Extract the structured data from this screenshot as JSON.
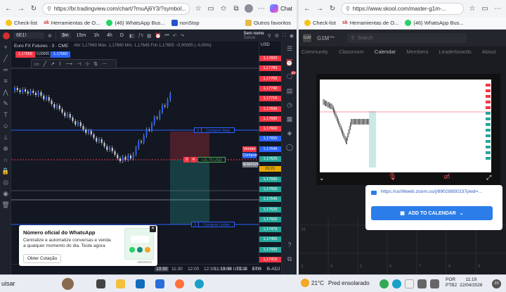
{
  "left_browser": {
    "url": "https://br.tradingview.com/chart/?muAj6Y3/?symbol...",
    "profile_btn": "Chat",
    "bookmarks": [
      "Check-list",
      "Herramientas de O...",
      "(46) WhatsApp Bus...",
      "nonStop"
    ],
    "other_favorites": "Outros favoritos"
  },
  "tv": {
    "symbol": "6E1!",
    "timeframes": [
      "3m",
      "15m",
      "1h",
      "4h",
      "D"
    ],
    "active_tf": "3m",
    "sem_nome": "Sem nome",
    "sem_nome_sub": "Salvar",
    "instrument_title": "Euro FX Futures · 3 · CME",
    "ohlc": "Abr 1,17660  Máx. 1,17660  Mín. 1,17645  Fch 1,17655  −0,00005 (−0,00%)",
    "sell_price": "1,17655",
    "buy_price": "1,17660",
    "spread": "0,00005",
    "currency": "USD",
    "price_labels": [
      "1,17820",
      "1,17785",
      "1,17765",
      "1,17740",
      "1,17715",
      "1,17695",
      "1,17680",
      "1,17660",
      "1,17655",
      "1,17645",
      "1,17625",
      "1,17610",
      "1,17590",
      "1,17565",
      "1,17545",
      "1,17525",
      "1,17500",
      "1,17475",
      "1,17455",
      "1,17430",
      "1,17415"
    ],
    "stop_label": "Comprar Stop",
    "stop_qty": "3",
    "limit_label": "Comprar Limite",
    "limit_qty": "3",
    "position_qty": "3",
    "position_pnl": "+16,75 USD",
    "vender_tag": "Vender",
    "comprar_tag": "Comprar",
    "contract_tag": "6EM2026",
    "countdown": "01:21",
    "time_labels": [
      "11:30",
      "12:00",
      "12:30",
      "13:00",
      "13:30",
      "14:0"
    ],
    "active_time_label": "10:30",
    "clock": "11:19:39 UTC-3",
    "session": "ETH",
    "adj": "B-ADJ"
  },
  "whatsapp_toast": {
    "title": "Número oficial do WhatsApp",
    "body": "Centralize e automatize conversas e venda a qualquer momento do dia. Teste agora",
    "button": "Obter Cotação",
    "ad_tag": "ANÚNCIO"
  },
  "right_browser": {
    "url": "https://www.skool.com/master-g1m-...",
    "bookmarks": [
      "Check-list",
      "Herramientas de O...",
      "(46) WhatsApp Bus..."
    ],
    "brand": "G1M™",
    "search_placeholder": "Search",
    "tabs": [
      "Community",
      "Classroom",
      "Calendar",
      "Members",
      "Leaderboards",
      "About"
    ],
    "active_tab": "Calendar",
    "zoom_link": "https://us06web.zoom.us/j/89028850237pwd=...",
    "add_to_calendar": "ADD TO CALENDAR",
    "avatar_badge": "43"
  },
  "taskbar": {
    "search_text": "uisar",
    "weather_temp": "21°C",
    "weather_text": "Pred ensolarado",
    "lang_top": "POR",
    "lang_bottom": "PTB2",
    "time": "11:19",
    "date": "22/04/2026",
    "notif_count": "23"
  }
}
